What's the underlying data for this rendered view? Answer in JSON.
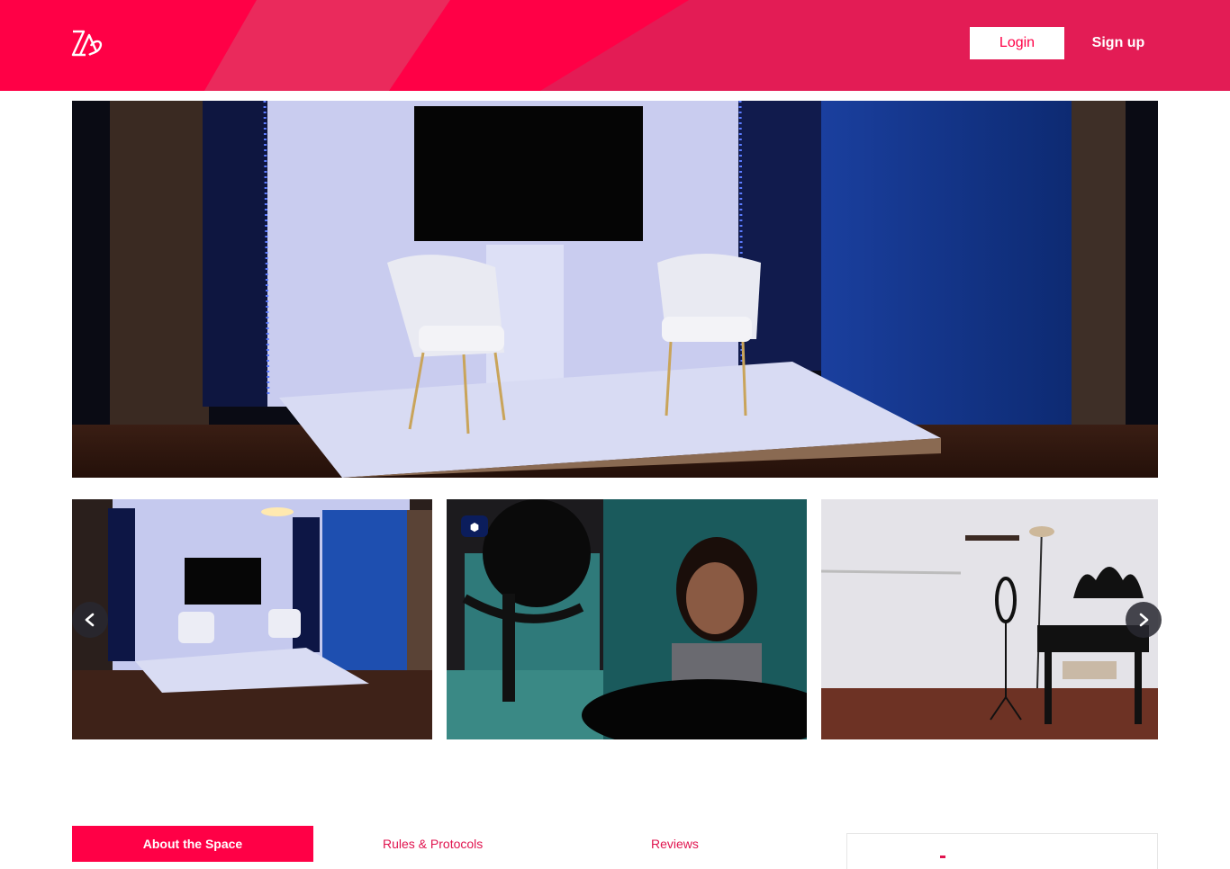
{
  "header": {
    "logo_icon": "brand-logo-icon",
    "login_label": "Login",
    "signup_label": "Sign up",
    "colors": {
      "primary": "#ff0046",
      "secondary": "#e31c55"
    }
  },
  "gallery": {
    "hero_alt": "Studio set with two white chairs and wall-mounted TV",
    "thumbnails": [
      {
        "alt": "Studio set wide view"
      },
      {
        "alt": "Portrait session with lighting"
      },
      {
        "alt": "Makeup vanity and ring light"
      }
    ],
    "prev_icon": "chevron-left-icon",
    "next_icon": "chevron-right-icon"
  },
  "tabs": {
    "about": "About the Space",
    "rules": "Rules & Protocols",
    "reviews": "Reviews"
  }
}
